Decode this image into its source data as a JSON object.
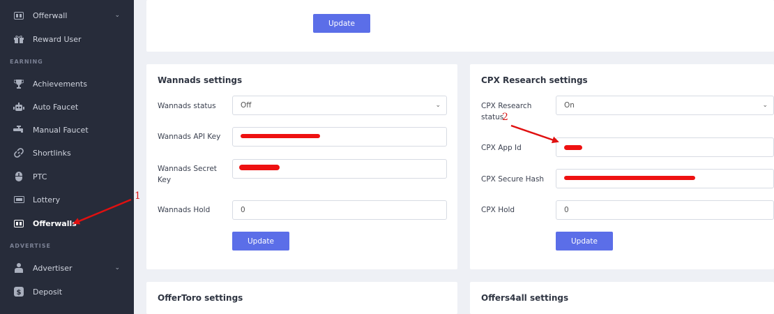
{
  "sidebar": {
    "sections": {
      "earning": "EARNING",
      "advertise": "ADVERTISE"
    },
    "items": [
      {
        "label": "Offerwall",
        "icon": "offerwall-icon"
      },
      {
        "label": "Reward User",
        "icon": "gift-icon"
      },
      {
        "label": "Achievements",
        "icon": "trophy-icon"
      },
      {
        "label": "Auto Faucet",
        "icon": "robot-icon"
      },
      {
        "label": "Manual Faucet",
        "icon": "faucet-icon"
      },
      {
        "label": "Shortlinks",
        "icon": "link-icon"
      },
      {
        "label": "PTC",
        "icon": "mouse-icon"
      },
      {
        "label": "Lottery",
        "icon": "ticket-icon"
      },
      {
        "label": "Offerwalls",
        "icon": "offerwall-icon"
      },
      {
        "label": "Advertiser",
        "icon": "users-icon"
      },
      {
        "label": "Deposit",
        "icon": "dollar-icon"
      }
    ]
  },
  "top_card": {
    "update_label": "Update"
  },
  "wannads": {
    "title": "Wannads settings",
    "status_label": "Wannads status",
    "status_value": "Off",
    "api_key_label": "Wannads API Key",
    "secret_key_label": "Wannads Secret Key",
    "hold_label": "Wannads Hold",
    "hold_value": "0",
    "update_label": "Update"
  },
  "cpx": {
    "title": "CPX Research settings",
    "status_label": "CPX Research status",
    "status_value": "On",
    "app_id_label": "CPX App Id",
    "secure_hash_label": "CPX Secure Hash",
    "hold_label": "CPX Hold",
    "hold_value": "0",
    "update_label": "Update"
  },
  "offertoro": {
    "title": "OfferToro settings"
  },
  "offers4all": {
    "title": "Offers4all settings"
  },
  "annotations": {
    "one": "1",
    "two": "2"
  },
  "colors": {
    "sidebar_bg": "#272c3a",
    "accent": "#5b6ee8",
    "annotation": "#d81818"
  }
}
